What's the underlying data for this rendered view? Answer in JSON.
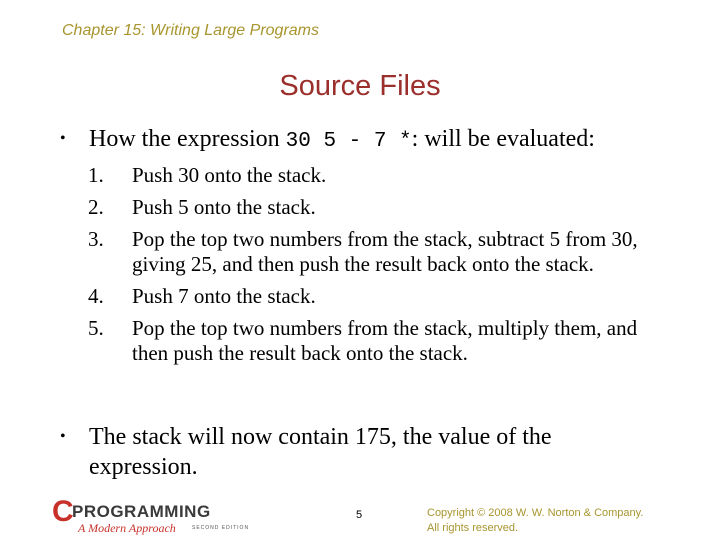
{
  "header": {
    "chapter": "Chapter 15: Writing Large Programs",
    "title": "Source Files"
  },
  "content": {
    "bullets": [
      {
        "prefix": "How the expression ",
        "code": "30 5 - 7 *",
        "suffix": ": will be evaluated:"
      },
      {
        "text": "The stack will now contain 175, the value of the expression."
      }
    ],
    "steps": [
      {
        "num": "1.",
        "text": "Push 30 onto the stack."
      },
      {
        "num": "2.",
        "text": "Push 5 onto the stack."
      },
      {
        "num": "3.",
        "text": "Pop the top two numbers from the stack, subtract 5 from 30, giving 25, and then push the result back onto the stack."
      },
      {
        "num": "4.",
        "text": "Push 7 onto the stack."
      },
      {
        "num": "5.",
        "text": "Pop the top two numbers from the stack, multiply them, and then push the result back onto the stack."
      }
    ]
  },
  "footer": {
    "logo": {
      "c": "C",
      "programming": "PROGRAMMING",
      "subtitle": "A Modern Approach",
      "edition": "SECOND EDITION"
    },
    "page_number": "5",
    "copyright_line1": "Copyright © 2008 W. W. Norton & Company.",
    "copyright_line2": "All rights reserved."
  },
  "colors": {
    "chapter": "#a8952e",
    "title": "#9b2f2b",
    "logo_red": "#c8312a"
  }
}
